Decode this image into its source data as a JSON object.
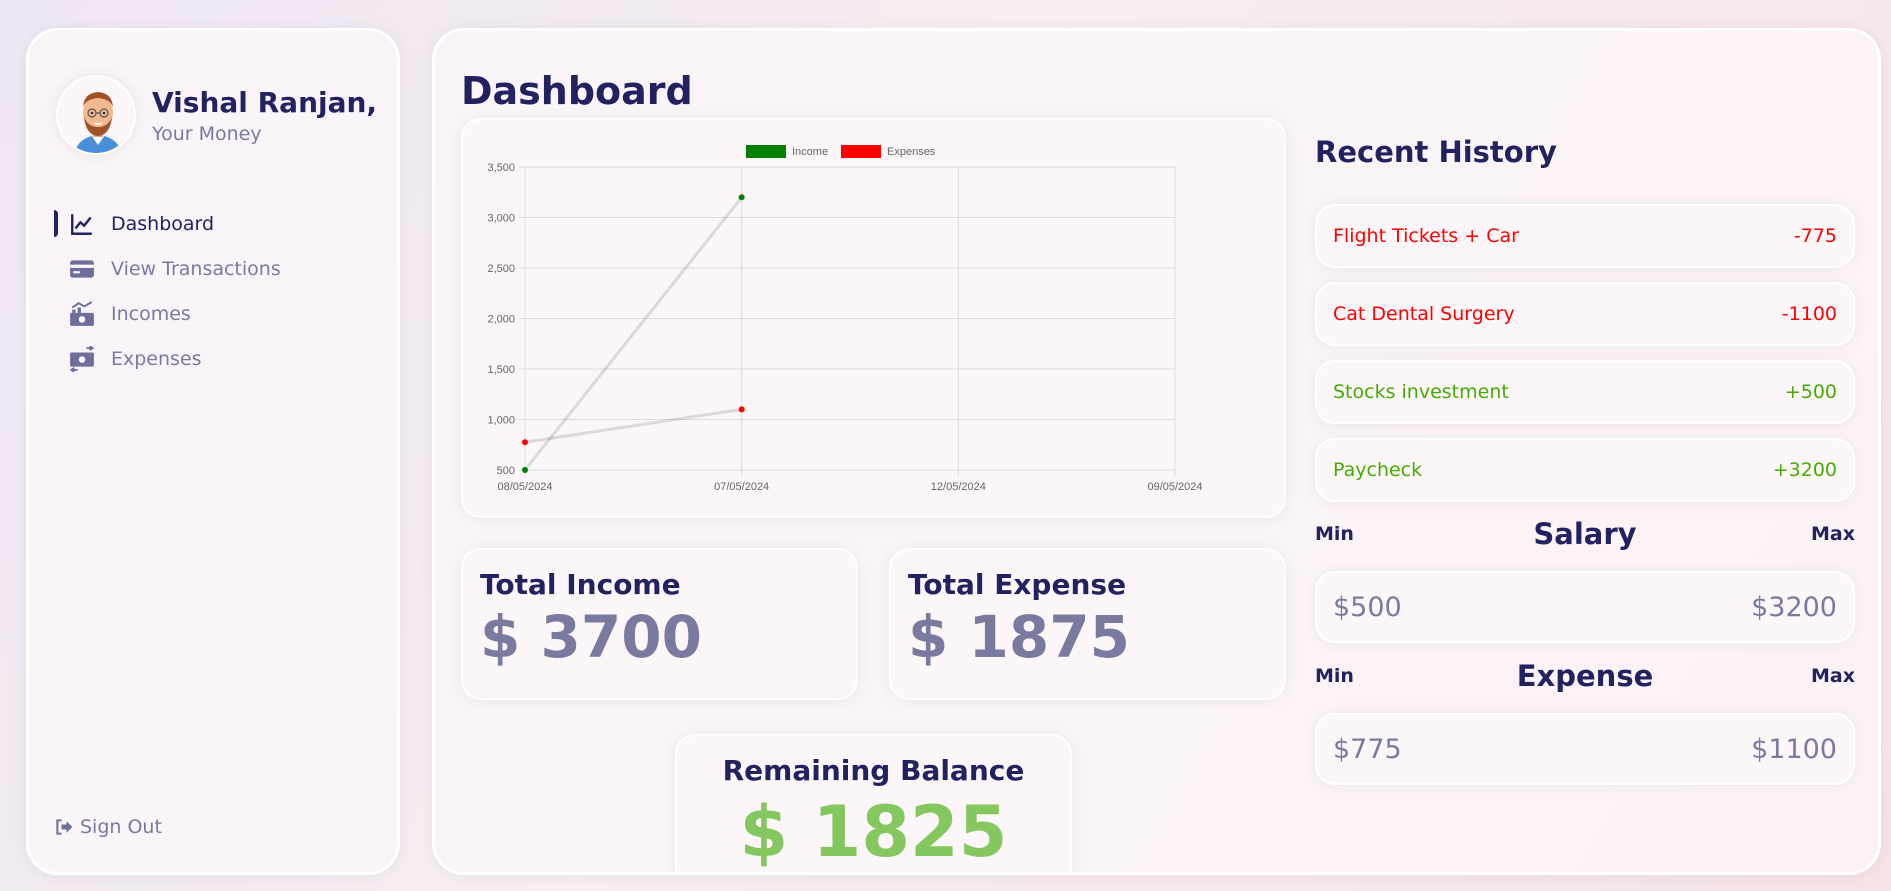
{
  "user": {
    "name": "Vishal Ranjan,",
    "subtitle": "Your Money"
  },
  "menu": [
    {
      "label": "Dashboard",
      "icon": "line-chart-icon",
      "active": true
    },
    {
      "label": "View Transactions",
      "icon": "credit-card-icon",
      "active": false
    },
    {
      "label": "Incomes",
      "icon": "money-trend-icon",
      "active": false
    },
    {
      "label": "Expenses",
      "icon": "money-exchange-icon",
      "active": false
    }
  ],
  "signout": {
    "label": "Sign Out",
    "icon": "sign-out-icon"
  },
  "page": {
    "title": "Dashboard"
  },
  "chart_data": {
    "type": "line",
    "categories": [
      "08/05/2024",
      "07/05/2024",
      "12/05/2024",
      "09/05/2024"
    ],
    "series": [
      {
        "name": "Income",
        "color": "#008000",
        "values": [
          500,
          3200,
          null,
          null
        ]
      },
      {
        "name": "Expenses",
        "color": "#ff0000",
        "values": [
          775,
          1100,
          null,
          null
        ]
      }
    ],
    "y_ticks": [
      500,
      1000,
      1500,
      2000,
      2500,
      3000,
      3500
    ],
    "y_tick_labels": [
      "500",
      "1,000",
      "1,500",
      "2,000",
      "2,500",
      "3,000",
      "3,500"
    ],
    "ylim": [
      500,
      3500
    ],
    "legend": "top",
    "grid": true
  },
  "totals": {
    "income_label": "Total Income",
    "income_value": "$ 3700",
    "expense_label": "Total Expense",
    "expense_value": "$ 1875",
    "balance_label": "Remaining Balance",
    "balance_value": "$ 1825"
  },
  "history": {
    "title": "Recent History",
    "items": [
      {
        "title": "Flight Tickets + Car",
        "amount": "-775",
        "color": "#ff0000"
      },
      {
        "title": "Cat Dental Surgery",
        "amount": "-1100",
        "color": "#ff0000"
      },
      {
        "title": "Stocks investment",
        "amount": "+500",
        "color": "#42ad00"
      },
      {
        "title": "Paycheck",
        "amount": "+3200",
        "color": "#42ad00"
      }
    ]
  },
  "salary": {
    "min_label": "Min",
    "title": "Salary",
    "max_label": "Max",
    "min": "$500",
    "max": "$3200"
  },
  "expense": {
    "min_label": "Min",
    "title": "Expense",
    "max_label": "Max",
    "min": "$775",
    "max": "$1100"
  },
  "colors": {
    "primary": "#222260",
    "muted": "#7a7aa0",
    "income": "#42ad00",
    "expense": "#ff0000",
    "balance": "#85c75f"
  }
}
